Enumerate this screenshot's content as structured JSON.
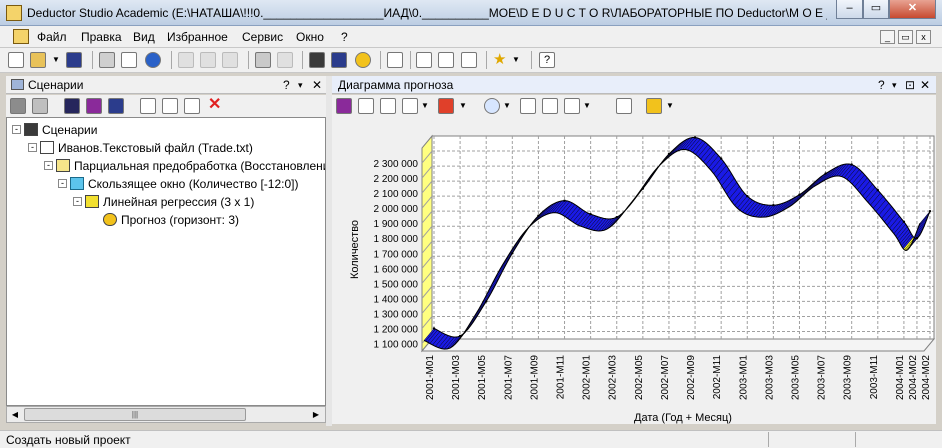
{
  "window": {
    "title": "Deductor Studio Academic (E:\\НАТАША\\!!!0.__________________ИАД\\0.__________МОЕ\\D E D U C T O R\\ЛАБОРАТОРНЫЕ ПО Deductor\\M O E ______л...",
    "min": "–",
    "max": "▭",
    "close": "✕"
  },
  "menu": [
    "Файл",
    "Правка",
    "Вид",
    "Избранное",
    "Сервис",
    "Окно",
    "?"
  ],
  "mdi": {
    "min": "_",
    "restore": "▭",
    "close": "x"
  },
  "left_panel": {
    "title": "Сценарии",
    "help": "?",
    "pin": "▾",
    "close": "✕"
  },
  "tree": [
    {
      "label": "Сценарии",
      "level": 0,
      "expander": "-",
      "icon": "scenarios-icon"
    },
    {
      "label": "Иванов.Текстовый файл (Trade.txt)",
      "level": 1,
      "expander": "-",
      "icon": "text-file-icon"
    },
    {
      "label": "Парциальная предобработка (Восстановление, А",
      "level": 2,
      "expander": "-",
      "icon": "preprocessing-icon"
    },
    {
      "label": "Скользящее окно (Количество [-12:0])",
      "level": 3,
      "expander": "-",
      "icon": "sliding-window-icon"
    },
    {
      "label": "Линейная регрессия (3 x 1)",
      "level": 4,
      "expander": "-",
      "icon": "linear-regression-icon"
    },
    {
      "label": "Прогноз (горизонт: 3)",
      "level": 5,
      "expander": "",
      "icon": "forecast-icon"
    }
  ],
  "scroll_grip": "|||",
  "right_panel": {
    "title": "Диаграмма прогноза",
    "help": "?",
    "pin": "▾",
    "float": "⊡",
    "close": "✕"
  },
  "status": {
    "text": "Создать новый проект"
  },
  "chart_data": {
    "type": "line",
    "style": "3d ribbon",
    "xlabel": "Дата (Год + Месяц)",
    "ylabel": "Количество",
    "categories": [
      "2001-M01",
      "2001-M03",
      "2001-M05",
      "2001-M07",
      "2001-M09",
      "2001-M11",
      "2002-M01",
      "2002-M03",
      "2002-M05",
      "2002-M07",
      "2002-M09",
      "2002-M11",
      "2003-M01",
      "2003-M03",
      "2003-M05",
      "2003-M07",
      "2003-M09",
      "2003-M11",
      "2004-M01",
      "2004-M02",
      "2004-M02"
    ],
    "x": [
      1,
      3,
      5,
      7,
      9,
      11,
      13,
      15,
      17,
      19,
      21,
      23,
      25,
      27,
      29,
      31,
      33,
      35,
      37,
      38,
      39
    ],
    "series": [
      {
        "values": [
          1120000,
          1070000,
          1300000,
          1620000,
          1870000,
          1970000,
          1880000,
          1860000,
          2050000,
          2280000,
          2390000,
          2250000,
          2000000,
          1940000,
          2010000,
          2150000,
          2210000,
          2040000,
          1830000,
          1720000,
          1900000
        ]
      }
    ],
    "yticks": [
      1100000,
      1200000,
      1300000,
      1400000,
      1500000,
      1600000,
      1700000,
      1800000,
      1900000,
      2000000,
      2100000,
      2200000,
      2300000
    ],
    "yticklabels": [
      "1 100 000",
      "1 200 000",
      "1 300 000",
      "1 400 000",
      "1 500 000",
      "1 600 000",
      "1 700 000",
      "1 800 000",
      "1 900 000",
      "2 000 000",
      "2 100 000",
      "2 200 000",
      "2 300 000"
    ],
    "ylim": [
      1050000,
      2400000
    ],
    "grid": true,
    "colors": {
      "ribbon": "#1a1ae6",
      "ribbon_edge": "#000000",
      "highlight": "#ffff33",
      "wall": "#ffff80",
      "plot_bg": "#ffffff"
    }
  }
}
